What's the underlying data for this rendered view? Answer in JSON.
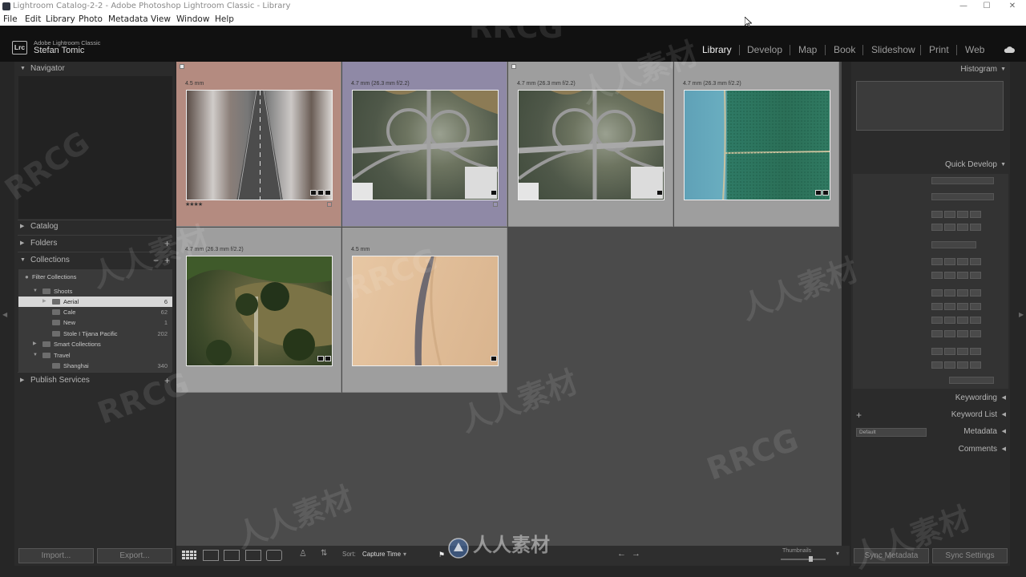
{
  "window": {
    "title": "Lightroom Catalog-2-2 - Adobe Photoshop Lightroom Classic - Library",
    "controls": [
      "—",
      "☐",
      "✕"
    ]
  },
  "menu": [
    "File",
    "Edit",
    "Library",
    "Photo",
    "Metadata",
    "View",
    "Window",
    "Help"
  ],
  "identity": {
    "badge": "Lrc",
    "product": "Adobe Lightroom Classic",
    "user": "Stefan Tomic"
  },
  "modules": [
    "Library",
    "Develop",
    "Map",
    "Book",
    "Slideshow",
    "Print",
    "Web"
  ],
  "active_module": "Library",
  "left_panel": {
    "navigator": "Navigator",
    "catalog": "Catalog",
    "folders": "Folders",
    "collections": "Collections",
    "filter_collections": "Filter Collections",
    "tree": [
      {
        "label": "Shoots",
        "count": ""
      },
      {
        "label": "Aerial",
        "count": "6"
      },
      {
        "label": "Cale",
        "count": "62"
      },
      {
        "label": "New",
        "count": "1"
      },
      {
        "label": "Stole I Tijana Pacific",
        "count": "202"
      },
      {
        "label": "Smart Collections",
        "count": ""
      },
      {
        "label": "Travel",
        "count": ""
      },
      {
        "label": "Shanghai",
        "count": "340"
      }
    ],
    "publish_services": "Publish Services",
    "import_button": "Import...",
    "export_button": "Export..."
  },
  "grid": {
    "cells": [
      {
        "caption": "4.5 mm",
        "stars": "★★★★",
        "bg": "#b48b80"
      },
      {
        "caption": "4.7 mm (26.3 mm f/2.2)",
        "stars": "",
        "bg": "#8f89a6"
      },
      {
        "caption": "4.7 mm (26.3 mm f/2.2)",
        "stars": "",
        "bg": "#9e9e9e"
      },
      {
        "caption": "4.7 mm (26.3 mm f/2.2)",
        "stars": "",
        "bg": "#9e9e9e"
      },
      {
        "caption": "4.7 mm (26.3 mm f/2.2)",
        "stars": "",
        "bg": "#9e9e9e"
      },
      {
        "caption": "4.5 mm",
        "stars": "",
        "bg": "#9e9e9e"
      }
    ]
  },
  "toolbar": {
    "sort_label": "Sort:",
    "sort_value": "Capture Time",
    "thumbnails_label": "Thumbnails"
  },
  "right_panel": {
    "histogram": "Histogram",
    "quick_develop": "Quick Develop",
    "keywording": "Keywording",
    "keyword_list": "Keyword List",
    "metadata": "Metadata",
    "metadata_preset": "Default",
    "comments": "Comments",
    "sync_metadata_button": "Sync Metadata",
    "sync_settings_button": "Sync Settings"
  },
  "watermark": {
    "text_latin": "RRCG",
    "text_cjk": "人人素材"
  }
}
